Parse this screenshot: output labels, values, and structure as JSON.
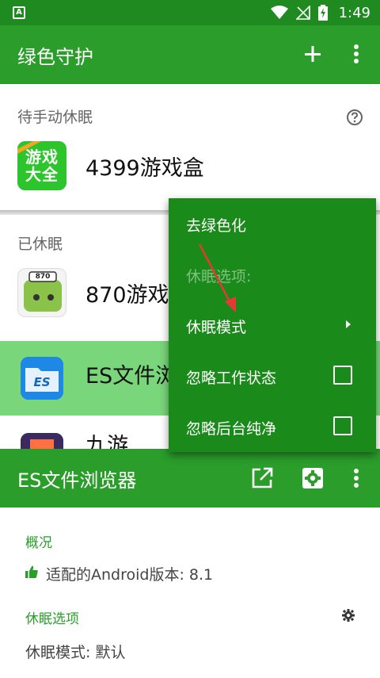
{
  "status_bar": {
    "notification_letter": "A",
    "time": "1:49"
  },
  "app_bar": {
    "title": "绿色守护"
  },
  "sections": {
    "pending": {
      "label": "待手动休眠"
    },
    "hibernated": {
      "label": "已休眠"
    }
  },
  "apps": {
    "pending": [
      {
        "name": "4399游戏盒",
        "icon_text": "游戏大全"
      }
    ],
    "hibernated": [
      {
        "name": "870游戏",
        "icon_text": "870"
      },
      {
        "name": "ES文件浏",
        "icon_text": "ES"
      },
      {
        "name": "九游",
        "icon_text": ""
      }
    ]
  },
  "menu": {
    "items": [
      {
        "label": "去绿色化"
      },
      {
        "label": "休眠选项:"
      },
      {
        "label": "休眠模式"
      },
      {
        "label": "忽略工作状态"
      },
      {
        "label": "忽略后台纯净"
      }
    ]
  },
  "detail": {
    "title": "ES文件浏览器",
    "overview_label": "概况",
    "android_version": "适配的Android版本: 8.1",
    "hibernation_options_label": "休眠选项",
    "hibernation_mode": "休眠模式:  默认"
  },
  "colors": {
    "primary": "#2a9d2a",
    "status_bar": "#1f8a1f",
    "menu_bg": "#1a8a1a",
    "highlight_row": "#7ad67a",
    "annotation": "#e53935"
  }
}
